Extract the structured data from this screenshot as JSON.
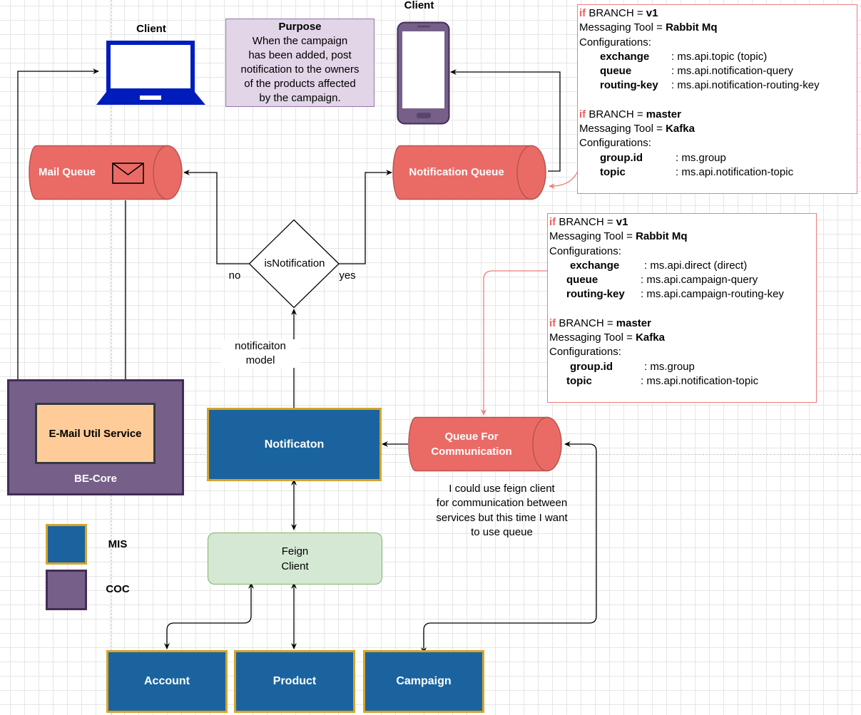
{
  "diagram": {
    "purpose": {
      "title": "Purpose",
      "lines": [
        "When the campaign",
        "has been added, post",
        "notification to the owners",
        "of the products affected",
        "by the campaign."
      ]
    },
    "clients": {
      "laptop_label": "Client",
      "phone_label": "Client"
    },
    "queues": {
      "mail_queue": "Mail Queue",
      "notification_queue": "Notification Queue",
      "queue_for_communication_line1": "Queue For",
      "queue_for_communication_line2": "Communication"
    },
    "decision": {
      "label": "isNotification",
      "no_label": "no",
      "yes_label": "yes"
    },
    "edge_labels": {
      "notification_model_line1": "notificaiton",
      "notification_model_line2": "model"
    },
    "services": {
      "notification": "Notificaton",
      "email_util": "E-Mail Util Service",
      "be_core": "BE-Core",
      "feign_line1": "Feign",
      "feign_line2": "Client",
      "account": "Account",
      "product": "Product",
      "campaign": "Campaign"
    },
    "note": {
      "lines": [
        "I could use feign client",
        "for communication between",
        "services but this time I want",
        "to use queue"
      ]
    },
    "legend": {
      "mis": "MIS",
      "coc": "COC",
      "mis_color": "#1b639f",
      "coc_color": "#76608a"
    },
    "config_top": {
      "v1": {
        "if": "if",
        "branch_prefix": " BRANCH = ",
        "branch": "v1",
        "tool_prefix": "Messaging Tool = ",
        "tool": "Rabbit Mq",
        "configs_label": "Configurations:",
        "entries": [
          {
            "key": "exchange",
            "value": ": ms.api.topic (topic)"
          },
          {
            "key": "queue",
            "value": ": ms.api.notification-query"
          },
          {
            "key": "routing-key",
            "value": ": ms.api.notification-routing-key"
          }
        ]
      },
      "master": {
        "if": "if",
        "branch_prefix": " BRANCH = ",
        "branch": "master",
        "tool_prefix": "Messaging Tool = ",
        "tool": "Kafka",
        "configs_label": "Configurations:",
        "entries": [
          {
            "key": "group.id",
            "value": ": ms.group"
          },
          {
            "key": "topic",
            "value": ": ms.api.notification-topic"
          }
        ]
      }
    },
    "config_bottom": {
      "v1": {
        "if": "if",
        "branch_prefix": " BRANCH = ",
        "branch": "v1",
        "tool_prefix": "Messaging Tool = ",
        "tool": "Rabbit Mq",
        "configs_label": "Configurations:",
        "entries": [
          {
            "key": "exchange",
            "value": ": ms.api.direct (direct)"
          },
          {
            "key": "queue",
            "value": ": ms.api.campaign-query"
          },
          {
            "key": "routing-key",
            "value": ": ms.api.campaign-routing-key"
          }
        ]
      },
      "master": {
        "if": "if",
        "branch_prefix": " BRANCH = ",
        "branch": "master",
        "tool_prefix": "Messaging Tool = ",
        "tool": "Kafka",
        "configs_label": "Configurations:",
        "entries": [
          {
            "key": "group.id",
            "value": ": ms.group"
          },
          {
            "key": "topic",
            "value": ": ms.api.notification-topic"
          }
        ]
      }
    },
    "colors": {
      "queue_fill": "#ea6b66",
      "queue_stroke": "#b85450",
      "config_border": "#f07c7c",
      "purpose_fill": "#e1d5e7",
      "email_fill": "#ffcc99",
      "feign_fill": "#d5e8d4",
      "device_blue": "#001dbc",
      "phone_purple": "#76608a"
    }
  }
}
